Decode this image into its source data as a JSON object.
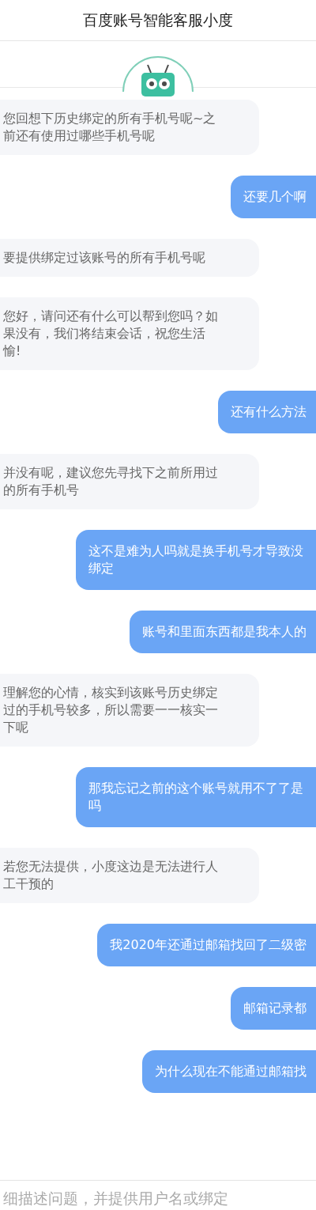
{
  "header": {
    "title": "百度账号智能客服小度"
  },
  "messages": [
    {
      "kind": "bot",
      "text": "您回想下历史绑定的所有手机号呢~之前还有使用过哪些手机号呢"
    },
    {
      "kind": "user",
      "text": "还要几个啊"
    },
    {
      "kind": "bot",
      "text": "要提供绑定过该账号的所有手机号呢"
    },
    {
      "kind": "bot",
      "text": "您好，请问还有什么可以帮到您吗？如果没有，我们将结束会话，祝您生活愉!"
    },
    {
      "kind": "user",
      "text": "还有什么方法"
    },
    {
      "kind": "bot",
      "text": "并没有呢，建议您先寻找下之前所用过的所有手机号"
    },
    {
      "kind": "user",
      "text": "这不是难为人吗就是换手机号才导致没绑定"
    },
    {
      "kind": "user",
      "text": "账号和里面东西都是我本人的"
    },
    {
      "kind": "bot",
      "text": "理解您的心情，核实到该账号历史绑定过的手机号较多，所以需要一一核实一下呢"
    },
    {
      "kind": "user",
      "text": "那我忘记之前的这个账号就用不了了是吗"
    },
    {
      "kind": "bot",
      "text": "若您无法提供，小度这边是无法进行人工干预的"
    },
    {
      "kind": "user",
      "text": "我2020年还通过邮箱找回了二级密"
    },
    {
      "kind": "user",
      "text": "邮箱记录都"
    },
    {
      "kind": "user",
      "text": "为什么现在不能通过邮箱找"
    }
  ],
  "input": {
    "placeholder": "细描述问题，并提供用户名或绑定"
  }
}
